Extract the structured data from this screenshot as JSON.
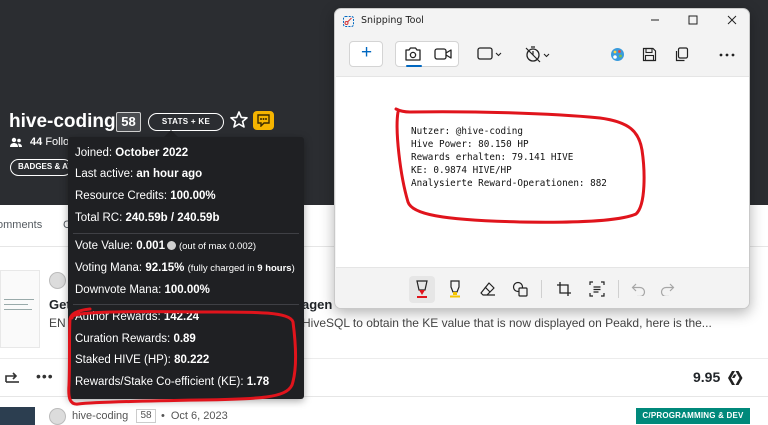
{
  "profile": {
    "name": "hive-coding",
    "reputation": "58",
    "stats_button": "STATS + KE",
    "followers_count": "44",
    "followers_label": "Follo",
    "badges_button": "BADGES & AV"
  },
  "tabs": {
    "comments": "omments",
    "partial": "C"
  },
  "tooltip": {
    "joined_label": "Joined:",
    "joined_value": "October 2022",
    "last_active_label": "Last active:",
    "last_active_value": "an hour ago",
    "rc_label": "Resource Credits:",
    "rc_value": "100.00%",
    "total_rc_label": "Total RC:",
    "total_rc_value": "240.59b / 240.59b",
    "vote_value_label": "Vote Value:",
    "vote_value": "0.001",
    "vote_value_note": "(out of max 0.002)",
    "voting_mana_label": "Voting Mana:",
    "voting_mana_value": "92.15%",
    "voting_mana_note_pre": "(fully charged in",
    "voting_mana_note_value": "9 hours",
    "voting_mana_note_post": ")",
    "downvote_mana_label": "Downvote Mana:",
    "downvote_mana_value": "100.00%",
    "author_rewards_label": "Author Rewards:",
    "author_rewards_value": "142.24",
    "curation_rewards_label": "Curation Rewards:",
    "curation_rewards_value": "0.89",
    "staked_hive_label": "Staked HIVE (HP):",
    "staked_hive_value": "80.222",
    "ke_label": "Rewards/Stake Co-efficient (KE):",
    "ke_value": "1.78"
  },
  "post": {
    "title_left": "Get",
    "title_right": "agen",
    "excerpt_left": "EN",
    "excerpt_right": "HiveSQL to obtain the KE value that is now displayed on Peakd, here is the...",
    "payout": "9.95"
  },
  "post2": {
    "author": "hive-coding",
    "reputation": "58",
    "date": "Oct 6, 2023",
    "category": "C/PROGRAMMING & DEV"
  },
  "snipping_tool": {
    "title": "Snipping Tool",
    "output_lines": [
      "Nutzer: @hive-coding",
      "Hive Power: 80.150 HP",
      "Rewards erhalten: 79.141 HIVE",
      "KE: 0.9874 HIVE/HP",
      "Analysierte Reward-Operationen: 882"
    ]
  },
  "colors": {
    "cover": "#2b2d31",
    "tooltip_bg": "#1f2023",
    "annotation_red": "#e0141c",
    "category_badge": "#00897b",
    "accent_blue": "#0067c0"
  }
}
